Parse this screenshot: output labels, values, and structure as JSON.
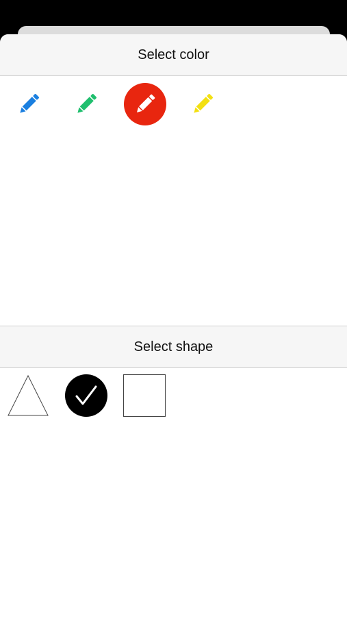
{
  "colors": {
    "header_title": "Select color",
    "options": [
      {
        "name": "blue",
        "color": "#1a7fe0",
        "selected": false
      },
      {
        "name": "green",
        "color": "#1fbf6e",
        "selected": false
      },
      {
        "name": "red",
        "color": "#e8260f",
        "selected": true
      },
      {
        "name": "yellow",
        "color": "#f3e012",
        "selected": false
      }
    ],
    "icon": "pencil-icon"
  },
  "shapes": {
    "header_title": "Select shape",
    "options": [
      {
        "name": "triangle",
        "icon": "triangle-icon",
        "selected": false
      },
      {
        "name": "circle",
        "icon": "circle-check-icon",
        "selected": true
      },
      {
        "name": "square",
        "icon": "square-icon",
        "selected": false
      }
    ]
  }
}
